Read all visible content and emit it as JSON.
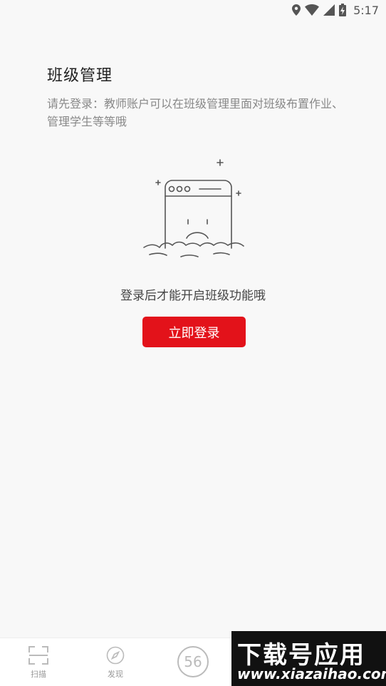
{
  "status_bar": {
    "time": "5:17",
    "icons": [
      "location-icon",
      "wifi-icon",
      "signal-icon",
      "battery-charging-icon"
    ]
  },
  "page": {
    "title": "班级管理",
    "description": "请先登录：教师账户可以在班级管理里面对班级布置作业、管理学生等等哦"
  },
  "empty_state": {
    "illustration": "sad-browser-icon",
    "message": "登录后才能开启班级功能哦",
    "button_label": "立即登录",
    "accent_color": "#e3121a"
  },
  "bottom_nav": {
    "items": [
      {
        "label": "扫描",
        "icon": "scan-icon"
      },
      {
        "label": "发现",
        "icon": "compass-icon"
      },
      {
        "label": "",
        "icon": "app-logo-56-icon"
      }
    ]
  },
  "watermark": {
    "main": "下载号应用",
    "url": "www.xiazaihao.com"
  }
}
